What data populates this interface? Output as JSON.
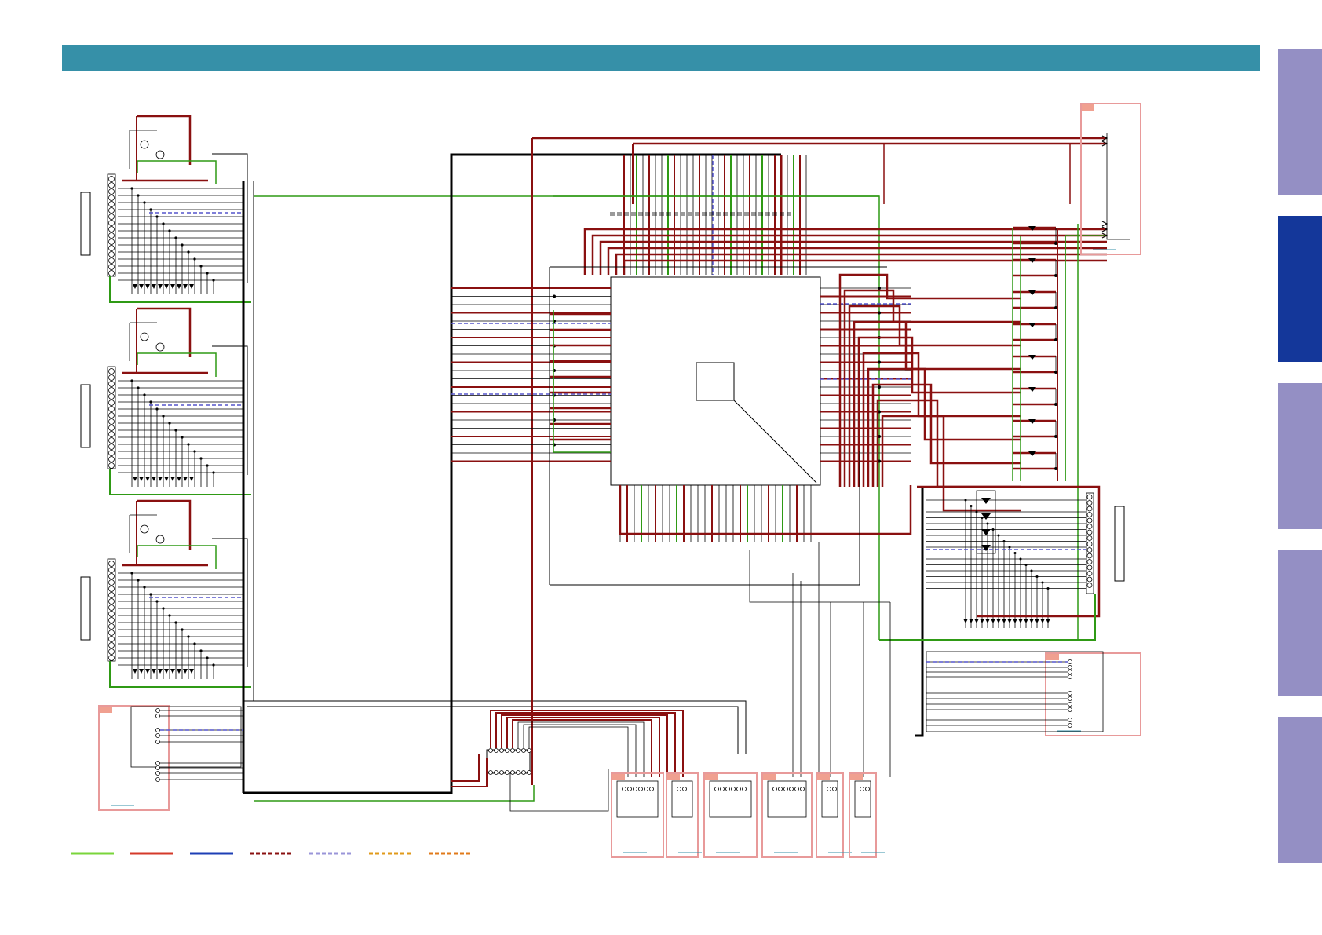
{
  "colors": {
    "header_bar": "#3690a8",
    "side_tab_inactive": "#948fc4",
    "side_tab_active": "#14379a",
    "wire": "#000000",
    "bus_red": "#8a1010",
    "ground_green": "#2f9a15",
    "signal_blue_dashed": "#5555cc",
    "block_pink": "#e89a9a",
    "label_fill": "#f0a090"
  },
  "side_tabs": [
    {
      "name": "tab-1",
      "active": false
    },
    {
      "name": "tab-2",
      "active": true
    },
    {
      "name": "tab-3",
      "active": false
    },
    {
      "name": "tab-4",
      "active": false
    },
    {
      "name": "tab-5",
      "active": false
    }
  ],
  "legend": [
    {
      "name": "legend-green-solid",
      "color": "#7ad53b",
      "style": "solid"
    },
    {
      "name": "legend-red-solid",
      "color": "#d43a2a",
      "style": "solid"
    },
    {
      "name": "legend-blue-solid",
      "color": "#1e3fb5",
      "style": "solid"
    },
    {
      "name": "legend-darkred-dashed",
      "color": "#8a1010",
      "style": "dashed"
    },
    {
      "name": "legend-lavender-dashed",
      "color": "#9a95d8",
      "style": "dashed"
    },
    {
      "name": "legend-orange-dashed",
      "color": "#e09a1a",
      "style": "dashed"
    },
    {
      "name": "legend-darkorange-dashed",
      "color": "#e07a1a",
      "style": "dashed"
    }
  ]
}
